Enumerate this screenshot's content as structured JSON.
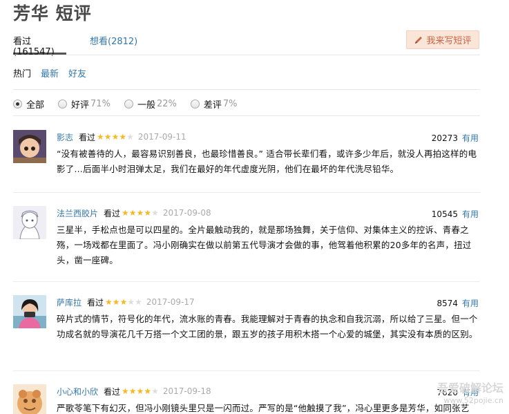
{
  "page": {
    "title": "芳华 短评"
  },
  "tabs": [
    {
      "label": "看过(161547)"
    },
    {
      "label": "想看(2812)"
    }
  ],
  "write_button": {
    "label": "我来写短评"
  },
  "sort": {
    "hot": "热门",
    "latest": "最新",
    "friends": "好友"
  },
  "filters": [
    {
      "label": "全部",
      "pct": ""
    },
    {
      "label": "好评",
      "pct": "71%"
    },
    {
      "label": "一般",
      "pct": "22%"
    },
    {
      "label": "差评",
      "pct": "7%"
    }
  ],
  "comments": [
    {
      "user": "影志",
      "status": "看过",
      "rating": 4,
      "date": "2017-09-11",
      "votes": "20273",
      "useful": "有用",
      "text": "“没有被善待的人，最容易识别善良，也最珍惜善良。” 适合带长辈们看，或许多少年后，就没人再拍这样的电影了…后面半小时泪弹太足，我们在最好的年代虚度光阴，他们在最坏的年代洗尽铅华。"
    },
    {
      "user": "法兰西胶片",
      "status": "看过",
      "rating": 4,
      "date": "2017-09-08",
      "votes": "10545",
      "useful": "有用",
      "text": "三星半，手松点也是可以四星的。全片最触动我的，就是那场独舞，关于信仰、对集体主义的控诉、青春之殇，一场戏都在里面了。冯小刚确实在做以前第五代导演才会做的事，他驾着他积累的20多年的名声，扭过头，凿一座碑。"
    },
    {
      "user": "萨库拉",
      "status": "看过",
      "rating": 3,
      "date": "2017-09-17",
      "votes": "8574",
      "useful": "有用",
      "text": "碎片式的情节，符号化的年代，流水账的青春。我能理解对于青春的执念和自我沉溺，所以给了三星。但一个功成名就的导演花几千万搭一个文工团的景，跟五岁的孩子用积木搭一个心爱的城堡，其实没有本质的区别。"
    },
    {
      "user": "小心和小欣",
      "status": "看过",
      "rating": 4,
      "date": "2017-09-18",
      "votes": "7620",
      "useful": "有用",
      "text": "严歌苓笔下有幻灭，但冯小刚镜头里只是一闪而过。严写的是“他触摸了我”，冯心里更多是芳华，如同张艺"
    }
  ],
  "watermark": {
    "line1": "吾爱破解论坛",
    "line2": "www.52pojie.cn"
  },
  "colors": {
    "link": "#3377aa",
    "star": "#f5b826",
    "button_bg": "#fae6d9",
    "button_text": "#ca6445"
  }
}
